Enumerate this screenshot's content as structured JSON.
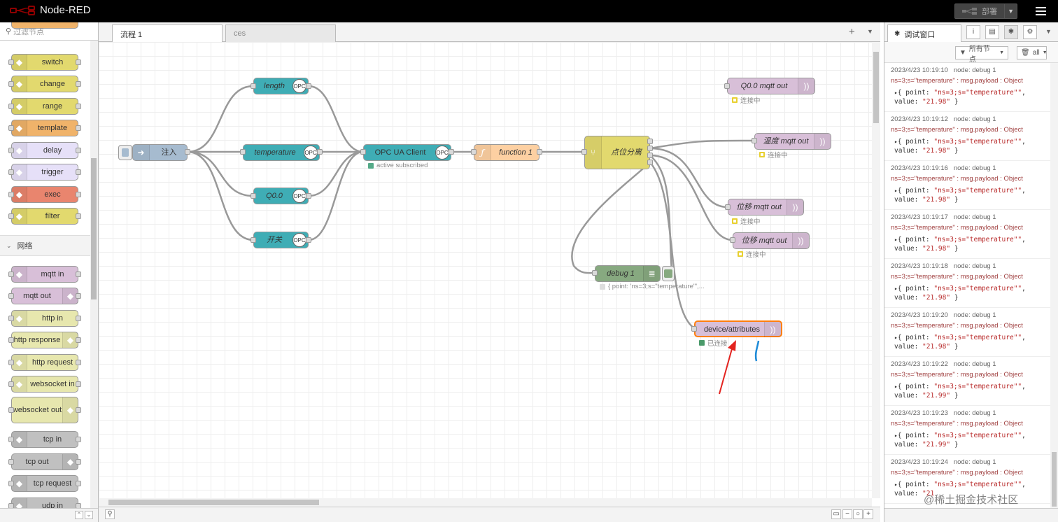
{
  "app": {
    "title": "Node-RED"
  },
  "header": {
    "deploy_label": "部署"
  },
  "palette": {
    "search_placeholder": "过滤节点",
    "category": "网络",
    "nodes": [
      {
        "label": "switch",
        "color": "#e2d96e"
      },
      {
        "label": "change",
        "color": "#e2d96e"
      },
      {
        "label": "range",
        "color": "#e2d96e"
      },
      {
        "label": "template",
        "color": "#f0b36a"
      },
      {
        "label": "delay",
        "color": "#e6e0f8"
      },
      {
        "label": "trigger",
        "color": "#e6e0f8"
      },
      {
        "label": "exec",
        "color": "#e9856e"
      },
      {
        "label": "filter",
        "color": "#e2d96e"
      },
      {
        "label": "mqtt in",
        "color": "#d8bfd8"
      },
      {
        "label": "mqtt out",
        "color": "#d8bfd8"
      },
      {
        "label": "http in",
        "color": "#e7e7ae"
      },
      {
        "label": "http response",
        "color": "#e7e7ae"
      },
      {
        "label": "http request",
        "color": "#e7e7ae"
      },
      {
        "label": "websocket in",
        "color": "#e7e7ae"
      },
      {
        "label": "websocket out",
        "color": "#e7e7ae"
      },
      {
        "label": "tcp in",
        "color": "#c0c0c0"
      },
      {
        "label": "tcp out",
        "color": "#c0c0c0"
      },
      {
        "label": "tcp request",
        "color": "#c0c0c0"
      },
      {
        "label": "udp in",
        "color": "#c0c0c0"
      }
    ]
  },
  "workspace": {
    "tabs": [
      {
        "label": "流程 1"
      },
      {
        "label": "ces"
      }
    ]
  },
  "flow": {
    "inject": "注入",
    "length": "length",
    "temperature": "temperature",
    "q00": "Q0.0",
    "switch_cn": "开关",
    "opc_client": "OPC UA Client",
    "opc_status": "active subscribed",
    "function1": "function 1",
    "split": "点位分离",
    "q00_out": "Q0.0 mqtt out",
    "temp_out": "温度 mqtt out",
    "disp_out1": "位移 mqtt out",
    "disp_out2": "位移 mqtt out",
    "connecting": "连接中",
    "debug1": "debug 1",
    "debug_status": "{ point: 'ns=3;s=\"temperature\"',...",
    "device_attr": "device/attributes",
    "connected": "已连接",
    "opc_badge": "OPC",
    "colors": {
      "opc": "#3fadb5",
      "function": "#fdd0a2",
      "switch": "#e2d96e",
      "mqtt": "#d8bfd8",
      "debug": "#87a980",
      "inject": "#a6bbcf"
    }
  },
  "sidebar": {
    "tab_label": "调试窗口",
    "filter_label": "所有节点",
    "clear_label": "all",
    "messages": [
      {
        "time": "2023/4/23 10:19:10",
        "node": "node: debug 1",
        "topic": "ns=3;s=\"temperature\" : msg.payload : Object",
        "line1": "{ point: ",
        "point": "\"ns=3;s=\"temperature\"\"",
        "line2": "value: ",
        "value": "\"21.98\"",
        "end": " }"
      },
      {
        "time": "2023/4/23 10:19:12",
        "node": "node: debug 1",
        "topic": "ns=3;s=\"temperature\" : msg.payload : Object",
        "line1": "{ point: ",
        "point": "\"ns=3;s=\"temperature\"\"",
        "line2": "value: ",
        "value": "\"21.98\"",
        "end": " }"
      },
      {
        "time": "2023/4/23 10:19:16",
        "node": "node: debug 1",
        "topic": "ns=3;s=\"temperature\" : msg.payload : Object",
        "line1": "{ point: ",
        "point": "\"ns=3;s=\"temperature\"\"",
        "line2": "value: ",
        "value": "\"21.98\"",
        "end": " }"
      },
      {
        "time": "2023/4/23 10:19:17",
        "node": "node: debug 1",
        "topic": "ns=3;s=\"temperature\" : msg.payload : Object",
        "line1": "{ point: ",
        "point": "\"ns=3;s=\"temperature\"\"",
        "line2": "value: ",
        "value": "\"21.98\"",
        "end": " }"
      },
      {
        "time": "2023/4/23 10:19:18",
        "node": "node: debug 1",
        "topic": "ns=3;s=\"temperature\" : msg.payload : Object",
        "line1": "{ point: ",
        "point": "\"ns=3;s=\"temperature\"\"",
        "line2": "value: ",
        "value": "\"21.98\"",
        "end": " }"
      },
      {
        "time": "2023/4/23 10:19:20",
        "node": "node: debug 1",
        "topic": "ns=3;s=\"temperature\" : msg.payload : Object",
        "line1": "{ point: ",
        "point": "\"ns=3;s=\"temperature\"\"",
        "line2": "value: ",
        "value": "\"21.98\"",
        "end": " }"
      },
      {
        "time": "2023/4/23 10:19:22",
        "node": "node: debug 1",
        "topic": "ns=3;s=\"temperature\" : msg.payload : Object",
        "line1": "{ point: ",
        "point": "\"ns=3;s=\"temperature\"\"",
        "line2": "value: ",
        "value": "\"21.99\"",
        "end": " }"
      },
      {
        "time": "2023/4/23 10:19:23",
        "node": "node: debug 1",
        "topic": "ns=3;s=\"temperature\" : msg.payload : Object",
        "line1": "{ point: ",
        "point": "\"ns=3;s=\"temperature\"\"",
        "line2": "value: ",
        "value": "\"21.99\"",
        "end": " }"
      },
      {
        "time": "2023/4/23 10:19:24",
        "node": "node: debug 1",
        "topic": "ns=3;s=\"temperature\" : msg.payload : Object",
        "line1": "{ point: ",
        "point": "\"ns=3;s=\"temperature\"\"",
        "line2": "value: ",
        "value": "\"21",
        "end": ""
      }
    ]
  },
  "watermark": "@稀土掘金技术社区"
}
